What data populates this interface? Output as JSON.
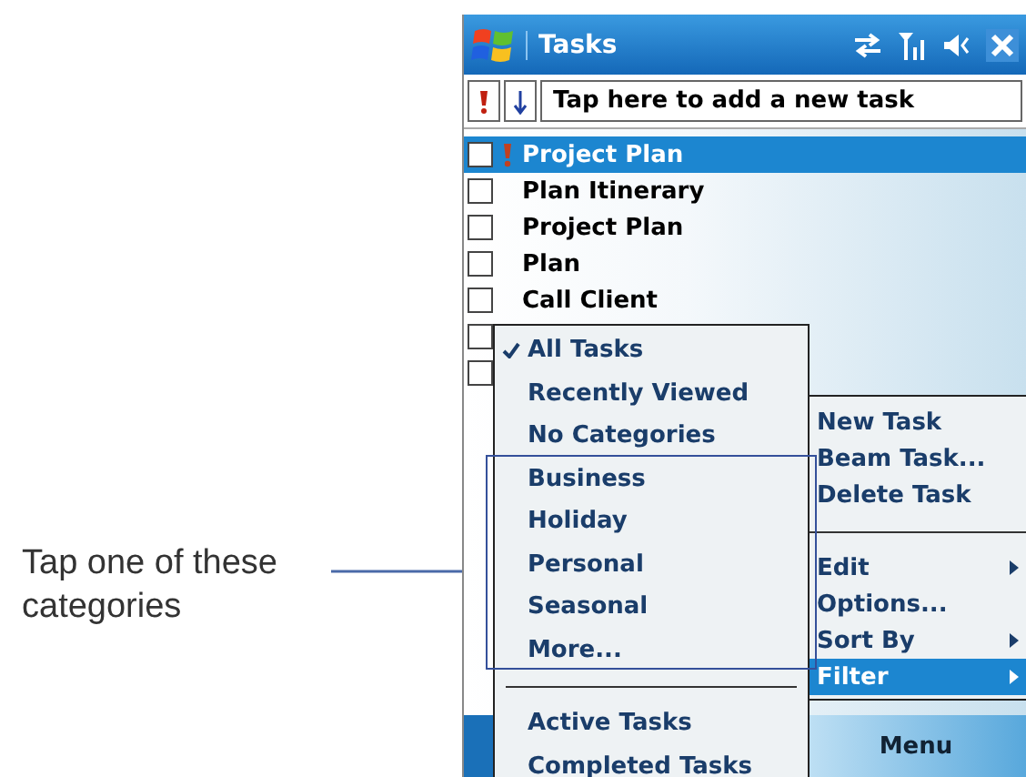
{
  "callout": {
    "text": "Tap one of these categories"
  },
  "window": {
    "title": "Tasks"
  },
  "toolbar": {
    "placeholder": "Tap here to add a new task"
  },
  "tasks": [
    {
      "name": "Project Plan",
      "checked": false,
      "selected": true,
      "high_priority": true
    },
    {
      "name": "Plan Itinerary",
      "checked": false,
      "selected": false,
      "high_priority": false
    },
    {
      "name": "Project Plan",
      "checked": false,
      "selected": false,
      "high_priority": false
    },
    {
      "name": "Plan",
      "checked": false,
      "selected": false,
      "high_priority": false
    },
    {
      "name": "Call Client",
      "checked": false,
      "selected": false,
      "high_priority": false
    },
    {
      "checked": false,
      "selected": false
    },
    {
      "checked": false,
      "selected": false
    }
  ],
  "filter_menu": {
    "items": [
      {
        "kind": "item",
        "label": "All Tasks",
        "checked": true
      },
      {
        "kind": "item",
        "label": "Recently Viewed",
        "checked": false
      },
      {
        "kind": "item",
        "label": "No Categories",
        "checked": false
      },
      {
        "kind": "item",
        "label": "Business",
        "checked": false
      },
      {
        "kind": "item",
        "label": "Holiday",
        "checked": false
      },
      {
        "kind": "item",
        "label": "Personal",
        "checked": false
      },
      {
        "kind": "item",
        "label": "Seasonal",
        "checked": false
      },
      {
        "kind": "item",
        "label": "More...",
        "checked": false
      },
      {
        "kind": "separator"
      },
      {
        "kind": "item",
        "label": "Active Tasks",
        "checked": false
      },
      {
        "kind": "item",
        "label": "Completed Tasks",
        "checked": false
      }
    ]
  },
  "menu": {
    "items": [
      {
        "kind": "item",
        "label": "New Task",
        "submenu": false,
        "selected": false
      },
      {
        "kind": "item",
        "label": "Beam Task...",
        "submenu": false,
        "selected": false
      },
      {
        "kind": "item",
        "label": "Delete Task",
        "submenu": false,
        "selected": false
      },
      {
        "kind": "separator"
      },
      {
        "kind": "item",
        "label": "Edit",
        "submenu": true,
        "selected": false
      },
      {
        "kind": "item",
        "label": "Options...",
        "submenu": false,
        "selected": false
      },
      {
        "kind": "item",
        "label": "Sort By",
        "submenu": true,
        "selected": false
      },
      {
        "kind": "item",
        "label": "Filter",
        "submenu": true,
        "selected": true
      }
    ]
  },
  "softkeys": {
    "right": "Menu"
  }
}
